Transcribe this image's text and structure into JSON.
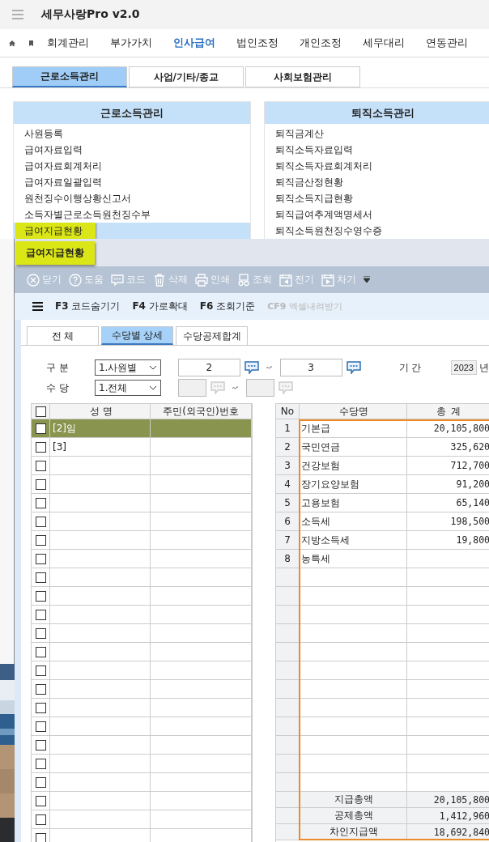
{
  "app": {
    "title": "세무사랑Pro  v2.0"
  },
  "nav": [
    {
      "label": "회계관리",
      "selected": false
    },
    {
      "label": "부가가치",
      "selected": false
    },
    {
      "label": "인사급여",
      "selected": true
    },
    {
      "label": "법인조정",
      "selected": false
    },
    {
      "label": "개인조정",
      "selected": false
    },
    {
      "label": "세무대리",
      "selected": false
    },
    {
      "label": "연동관리",
      "selected": false
    }
  ],
  "tabs": [
    {
      "label": "근로소득관리",
      "selected": true
    },
    {
      "label": "사업/기타/종교",
      "selected": false
    },
    {
      "label": "사회보험관리",
      "selected": false
    }
  ],
  "panels": [
    {
      "title": "근로소득관리",
      "items": [
        {
          "label": "사원등록",
          "selected": false
        },
        {
          "label": "급여자료입력",
          "selected": false
        },
        {
          "label": "급여자료회계처리",
          "selected": false
        },
        {
          "label": "급여자료일괄입력",
          "selected": false
        },
        {
          "label": "원천징수이행상황신고서",
          "selected": false
        },
        {
          "label": "소득자별근로소득원천징수부",
          "selected": false
        },
        {
          "label": "급여지급현황",
          "selected": true
        }
      ]
    },
    {
      "title": "퇴직소득관리",
      "items": [
        {
          "label": "퇴직금계산",
          "selected": false
        },
        {
          "label": "퇴직소득자료입력",
          "selected": false
        },
        {
          "label": "퇴직소득자료회계처리",
          "selected": false
        },
        {
          "label": "퇴직금산정현황",
          "selected": false
        },
        {
          "label": "퇴직소득지급현황",
          "selected": false
        },
        {
          "label": "퇴직급여추계액명세서",
          "selected": false
        },
        {
          "label": "퇴직소득원천징수영수증",
          "selected": false
        }
      ]
    }
  ],
  "tooltip": "급여지급현황",
  "toolbar": [
    {
      "kind": "close",
      "label": "닫기"
    },
    {
      "kind": "help",
      "label": "도움"
    },
    {
      "kind": "code",
      "label": "코드"
    },
    {
      "kind": "delete",
      "label": "삭제"
    },
    {
      "kind": "print",
      "label": "인쇄"
    },
    {
      "kind": "search",
      "label": "조회"
    },
    {
      "kind": "prev",
      "label": "전기"
    },
    {
      "kind": "next",
      "label": "차기"
    }
  ],
  "function_keys": [
    {
      "key": "F3",
      "label": "코드숨기기",
      "disabled": false
    },
    {
      "key": "F4",
      "label": "가로확대",
      "disabled": false
    },
    {
      "key": "F6",
      "label": "조회기준",
      "disabled": false
    },
    {
      "key": "CF9",
      "label": "엑셀내려받기",
      "disabled": true
    }
  ],
  "sub_tabs": [
    {
      "label": "전 체",
      "selected": false
    },
    {
      "label": "수당별 상세",
      "selected": true
    },
    {
      "label": "수당공제합계",
      "selected": false
    }
  ],
  "filters": [
    {
      "label": "구 분",
      "select": "1.사원별",
      "from": "2",
      "to": "3",
      "disabled": false
    },
    {
      "label": "수 당",
      "select": "1.전체",
      "disabled": true
    }
  ],
  "period": {
    "label": "기 간",
    "year": "2023",
    "unit": "년"
  },
  "employees": {
    "all_checked": false,
    "columns": [
      "성 명",
      "주민(외국인)번호"
    ],
    "rows": [
      {
        "name": "[2]임",
        "checked": false,
        "selected": true
      },
      {
        "name": "[3]",
        "checked": false,
        "selected": false
      },
      {
        "checked": false,
        "selected": false
      },
      {
        "checked": false,
        "selected": false
      },
      {
        "checked": false,
        "selected": false
      },
      {
        "checked": false,
        "selected": false
      },
      {
        "checked": false,
        "selected": false
      },
      {
        "checked": false,
        "selected": false
      },
      {
        "checked": false,
        "selected": false
      },
      {
        "checked": false,
        "selected": false
      },
      {
        "checked": false,
        "selected": false
      },
      {
        "checked": false,
        "selected": false
      },
      {
        "checked": false,
        "selected": false
      },
      {
        "checked": false,
        "selected": false
      },
      {
        "checked": false,
        "selected": false
      },
      {
        "checked": false,
        "selected": false
      },
      {
        "checked": false,
        "selected": false
      },
      {
        "checked": false,
        "selected": false
      },
      {
        "checked": false,
        "selected": false
      },
      {
        "checked": false,
        "selected": false
      },
      {
        "checked": false,
        "selected": false
      },
      {
        "checked": false,
        "selected": false
      },
      {
        "checked": false,
        "selected": false
      }
    ]
  },
  "allowances": {
    "columns": [
      "No",
      "수당명",
      "총 계"
    ],
    "rows": [
      {
        "no": "1",
        "name": "기본급",
        "total": "20,105,800"
      },
      {
        "no": "2",
        "name": "국민연금",
        "total": "325,620"
      },
      {
        "no": "3",
        "name": "건강보험",
        "total": "712,700"
      },
      {
        "no": "4",
        "name": "장기요양보험",
        "total": "91,200"
      },
      {
        "no": "5",
        "name": "고용보험",
        "total": "65,140"
      },
      {
        "no": "6",
        "name": "소득세",
        "total": "198,500"
      },
      {
        "no": "7",
        "name": "지방소득세",
        "total": "19,800"
      },
      {
        "no": "8",
        "name": "농특세"
      }
    ],
    "summary": [
      {
        "label": "지급총액",
        "value": "20,105,800"
      },
      {
        "label": "공제총액",
        "value": "1,412,960"
      },
      {
        "label": "차인지급액",
        "value": "18,692,840"
      }
    ]
  }
}
